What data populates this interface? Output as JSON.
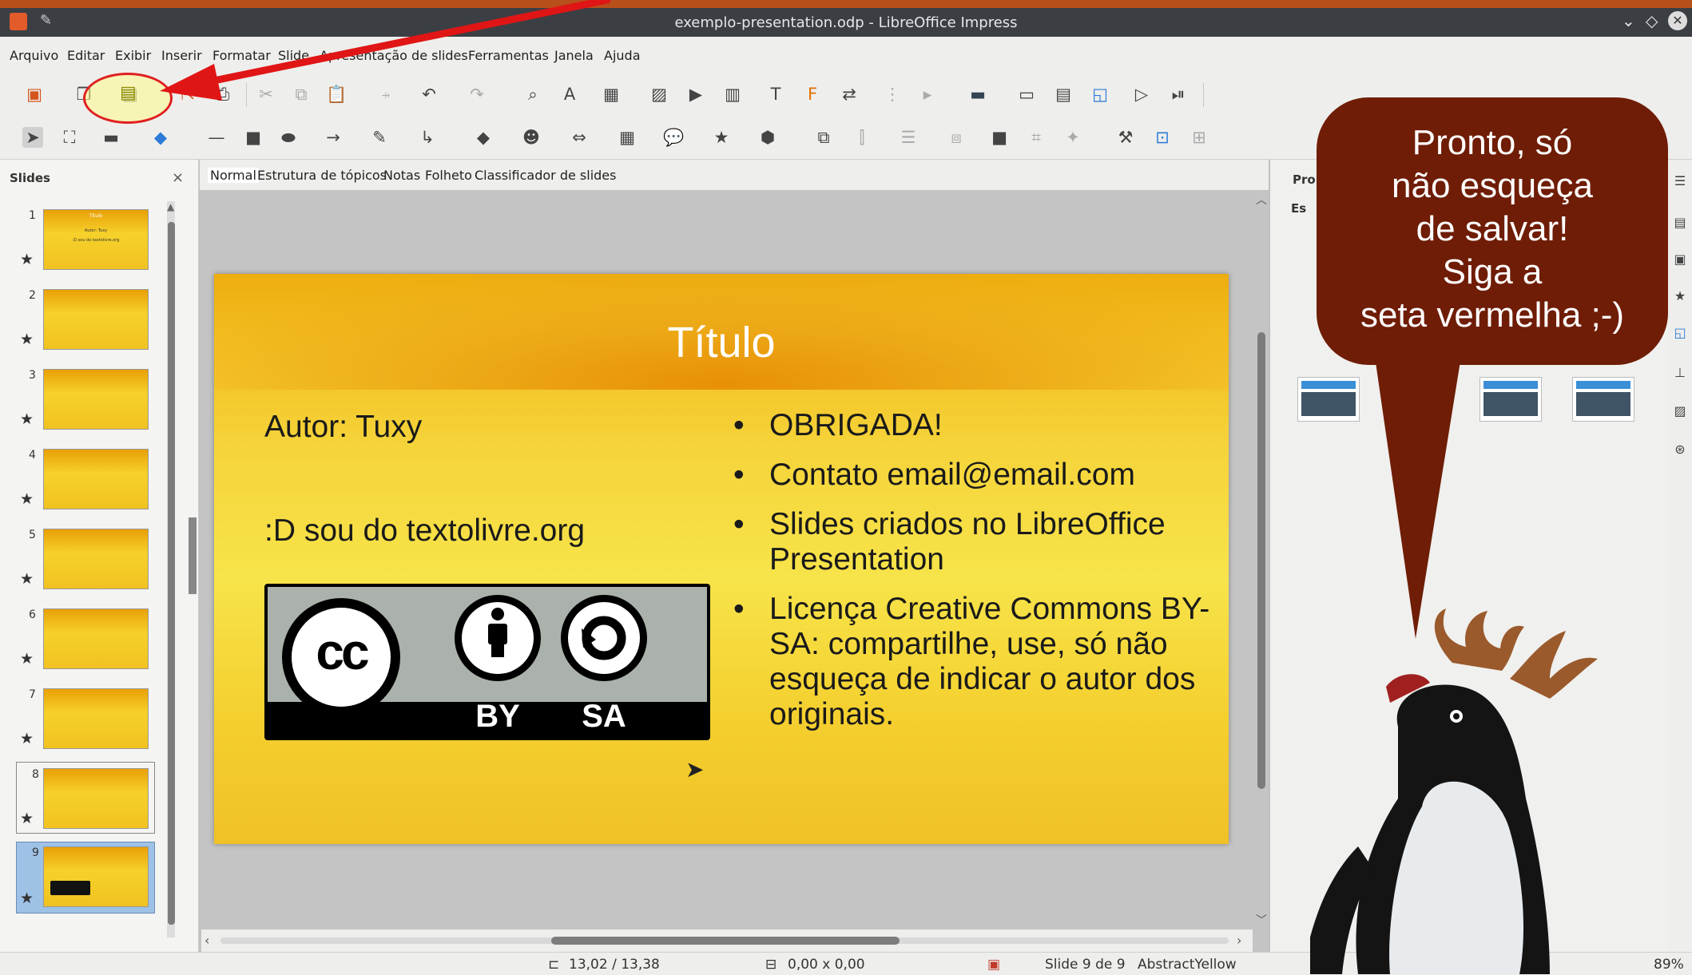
{
  "window": {
    "title": "exemplo-presentation.odp - LibreOffice Impress"
  },
  "menu": [
    "Arquivo",
    "Editar",
    "Exibir",
    "Inserir",
    "Formatar",
    "Slide",
    "Apresentação de slides",
    "Ferramentas",
    "Janela",
    "Ajuda"
  ],
  "slides_panel": {
    "title": "Slides",
    "close": "×",
    "numbers": [
      "1",
      "2",
      "3",
      "4",
      "5",
      "6",
      "7",
      "8",
      "9"
    ],
    "thumb1_title": "Título",
    "thumb1_line1": "Autor: Tuxy",
    "thumb1_line2": ":D sou do textolivre.org"
  },
  "view_tabs": [
    "Normal",
    "Estrutura de tópicos",
    "Notas",
    "Folheto",
    "Classificador de slides"
  ],
  "slide": {
    "title": "Título",
    "author": "Autor: Tuxy",
    "site": ":D sou do textolivre.org",
    "bullets": [
      "OBRIGADA!",
      "Contato email@email.com",
      "Slides criados no LibreOffice Presentation",
      "Licença Creative Commons BY-SA: compartilhe, use, só não esqueça de indicar o autor dos originais."
    ],
    "badge": {
      "cc": "cc",
      "by": "BY",
      "sa": "SA"
    }
  },
  "sidebar": {
    "header": "Pro",
    "sub": "Es"
  },
  "statusbar": {
    "position": "13,02 / 13,38",
    "size": "0,00 x 0,00",
    "slide_info": "Slide 9 de 9",
    "master": "AbstractYellow",
    "zoom": "89%"
  },
  "callout": {
    "lines": [
      "Pronto, só",
      "não esqueça",
      "de salvar!",
      "Siga a",
      "seta vermelha ;-)"
    ]
  },
  "colors": {
    "arrow": "#e01515",
    "bubble": "#6f1d06",
    "slide_bg": "#f3c52a"
  }
}
